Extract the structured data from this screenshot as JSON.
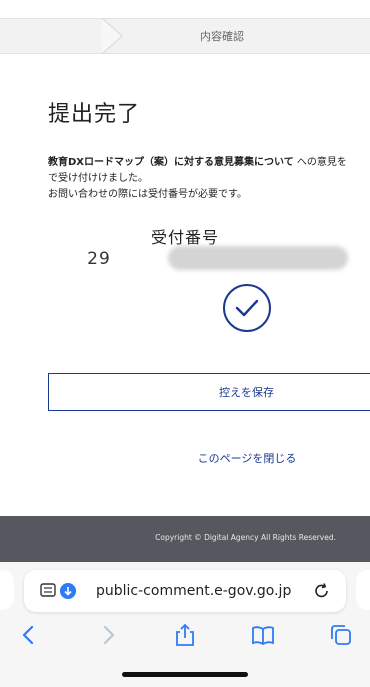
{
  "progress": {
    "current_step": "内容確認"
  },
  "page_title": "提出完了",
  "message": {
    "subject": "教育DXロードマップ（案）に対する意見募集について",
    "line1_tail": "への意見を",
    "line2": "で受け付けけました。",
    "line3": "お問い合わせの際には受付番号が必要です。"
  },
  "receipt": {
    "label": "受付番号",
    "number_visible": "29"
  },
  "buttons": {
    "save": "控えを保存",
    "close": "このページを閉じる"
  },
  "footer": {
    "copyright": "Copyright © Digital Agency All Rights Reserved."
  },
  "browser": {
    "url": "public-comment.e-gov.go.jp"
  },
  "colors": {
    "accent": "#1a3a8f",
    "footer_bg": "#55595f",
    "ios_blue": "#2f7bf6"
  }
}
